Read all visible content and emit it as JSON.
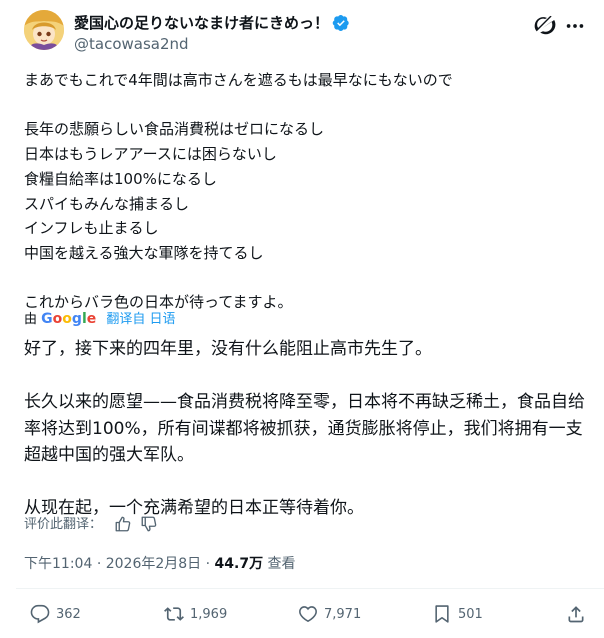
{
  "author": {
    "display_name": "愛国心の足りないなまけ者にきめっ！",
    "handle": "@tacowasa2nd",
    "avatar": "avatar-image",
    "verified_icon": "verified-badge-icon"
  },
  "header_icons": {
    "grok": "grok-icon",
    "more": "more-options-icon"
  },
  "post": {
    "original_text": "まあでもこれで4年間は高市さんを遮るもは最早なにもないので\n\n長年の悲願らしい食品消費税はゼロになるし\n日本はもうレアアースには困らないし\n食糧自給率は100%になるし\nスパイもみんな捕まるし\nインフレも止まるし\n中国を越える強大な軍隊を持てるし\n\nこれからバラ色の日本が待ってますよ。",
    "translated_by_prefix": "由",
    "translated_by_google": "Google",
    "translated_from_link": "翻译自 日语",
    "translation_text": "好了，接下来的四年里，没有什么能阻止高市先生了。\n\n长久以来的愿望——食品消费税将降至零，日本将不再缺乏稀土，食品自给率将达到100%，所有间谍都将被抓获，通货膨胀将停止，我们将拥有一支超越中国的强大军队。\n\n从现在起，一个充满希望的日本正等待着你。",
    "rate_label": "评价此翻译：",
    "rate_icons": [
      "thumbs-up-icon",
      "thumbs-down-icon"
    ]
  },
  "meta": {
    "time": "下午11:04",
    "separator": "·",
    "date": "2026年2月8日",
    "views_count": "44.7万",
    "views_label": "查看"
  },
  "actions": {
    "reply_count": "362",
    "repost_count": "1,969",
    "like_count": "7,971",
    "bookmark_count": "501",
    "icons": [
      "reply-icon",
      "repost-icon",
      "like-icon",
      "bookmark-icon",
      "share-icon"
    ]
  },
  "colors": {
    "text": "#0f1419",
    "secondary": "#536471",
    "link": "#1d9bf0",
    "divider": "#eff3f4"
  }
}
